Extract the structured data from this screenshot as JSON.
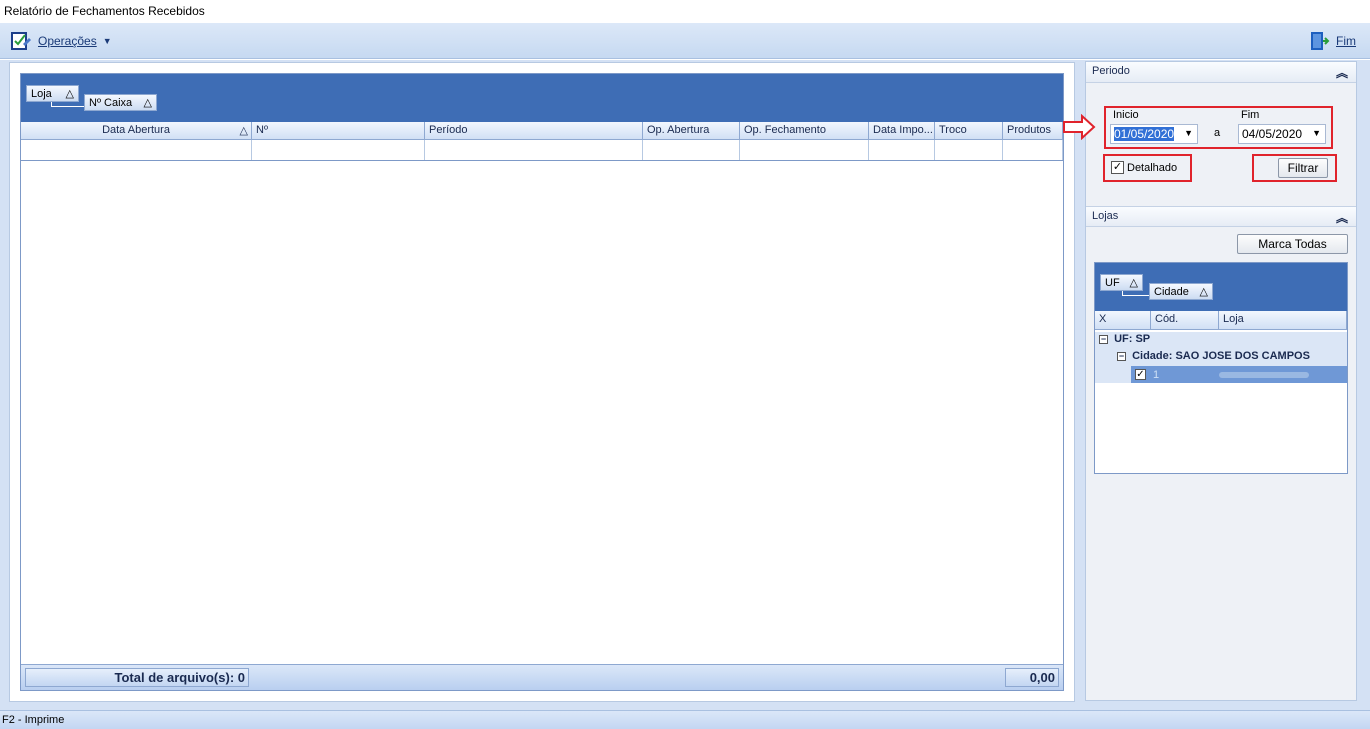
{
  "window": {
    "title": "Relatório de Fechamentos Recebidos"
  },
  "toolbar": {
    "operacoes_label": "Operações",
    "fim_label": "Fim"
  },
  "main_grid": {
    "group_by": [
      "Loja",
      "Nº Caixa"
    ],
    "columns": [
      "Data Abertura",
      "Nº",
      "Período",
      "Op. Abertura",
      "Op. Fechamento",
      "Data Impo...",
      "Troco",
      "Produtos"
    ],
    "footer_total": "Total de arquivo(s): 0",
    "footer_sum": "0,00"
  },
  "periodo": {
    "header": "Periodo",
    "inicio_label": "Inicio",
    "inicio_value": "01/05/2020",
    "sep": "a",
    "fim_label": "Fim",
    "fim_value": "04/05/2020",
    "detalhado_label": "Detalhado",
    "detalhado_checked": true,
    "filtrar_label": "Filtrar"
  },
  "lojas": {
    "header": "Lojas",
    "marca_todas_label": "Marca Todas",
    "group_by": [
      "UF",
      "Cidade"
    ],
    "columns": [
      "X",
      "Cód.",
      "Loja"
    ],
    "group_uf": "UF: SP",
    "group_cidade": "Cidade: SAO JOSE DOS CAMPOS",
    "rows": [
      {
        "checked": true,
        "cod": "1",
        "loja": ""
      }
    ]
  },
  "statusbar": {
    "text": "F2 - Imprime"
  },
  "colors": {
    "accent": "#3e6db5",
    "highlight": "#e0232c"
  }
}
